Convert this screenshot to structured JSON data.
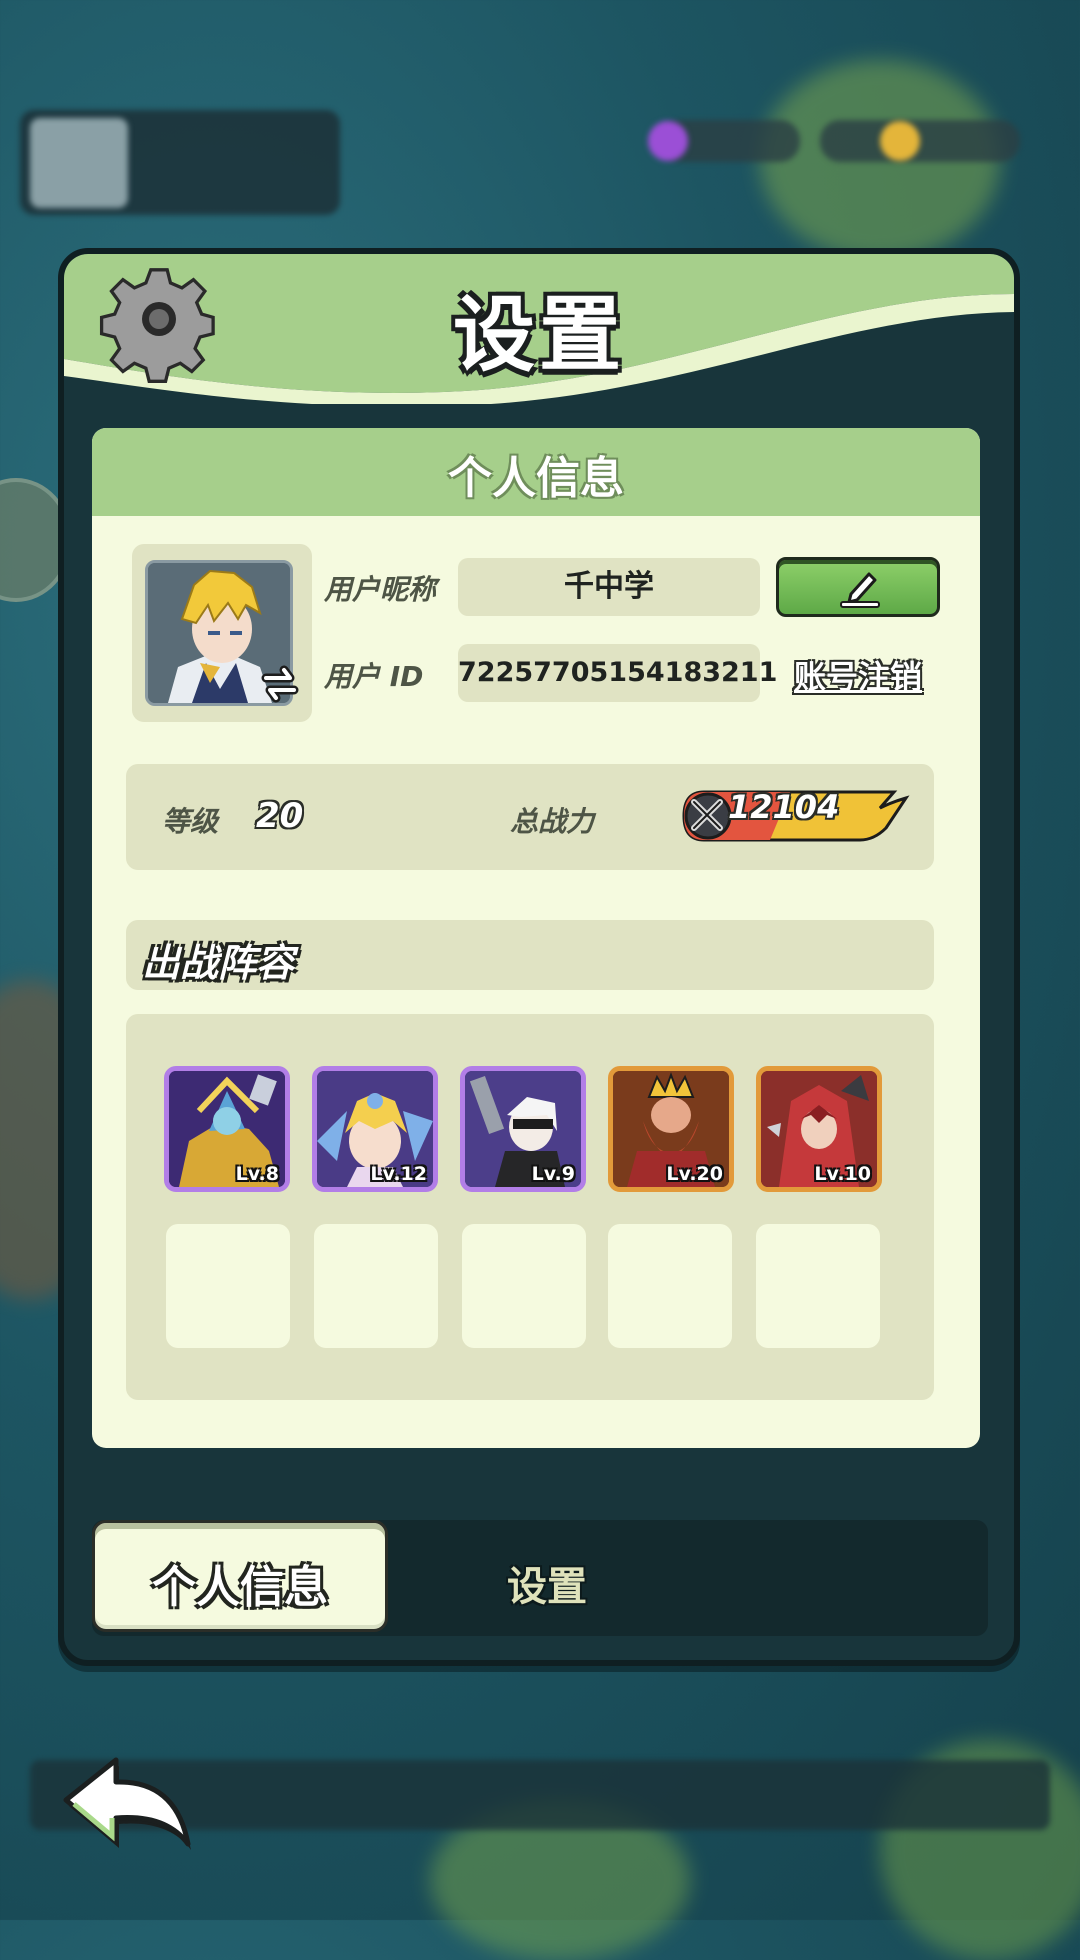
{
  "panel": {
    "title": "设置"
  },
  "profile": {
    "section_title": "个人信息",
    "nickname_label": "用户昵称",
    "nickname_value": "千中学",
    "id_label": "用户 ID",
    "id_value": "72257705154183211",
    "edit_icon": "pencil-icon",
    "cancel_account_label": "账号注销"
  },
  "stats": {
    "level_label": "等级",
    "level_value": "20",
    "power_label": "总战力",
    "power_value": "12104"
  },
  "lineup": {
    "title": "出战阵容",
    "heroes": [
      {
        "level": "Lv.8",
        "rarity": "purple"
      },
      {
        "level": "Lv.12",
        "rarity": "purple"
      },
      {
        "level": "Lv.9",
        "rarity": "purple"
      },
      {
        "level": "Lv.20",
        "rarity": "orange"
      },
      {
        "level": "Lv.10",
        "rarity": "orange"
      }
    ],
    "empty_slots": 5
  },
  "tabs": [
    {
      "label": "个人信息",
      "active": true
    },
    {
      "label": "设置",
      "active": false
    }
  ],
  "colors": {
    "header_green": "#a6cf8b",
    "card_bg": "#f5fadf",
    "field_bg": "#e0e3c3",
    "panel_dark": "#18353b",
    "purple_frame": "#b27ee7",
    "orange_frame": "#e29a3a"
  }
}
